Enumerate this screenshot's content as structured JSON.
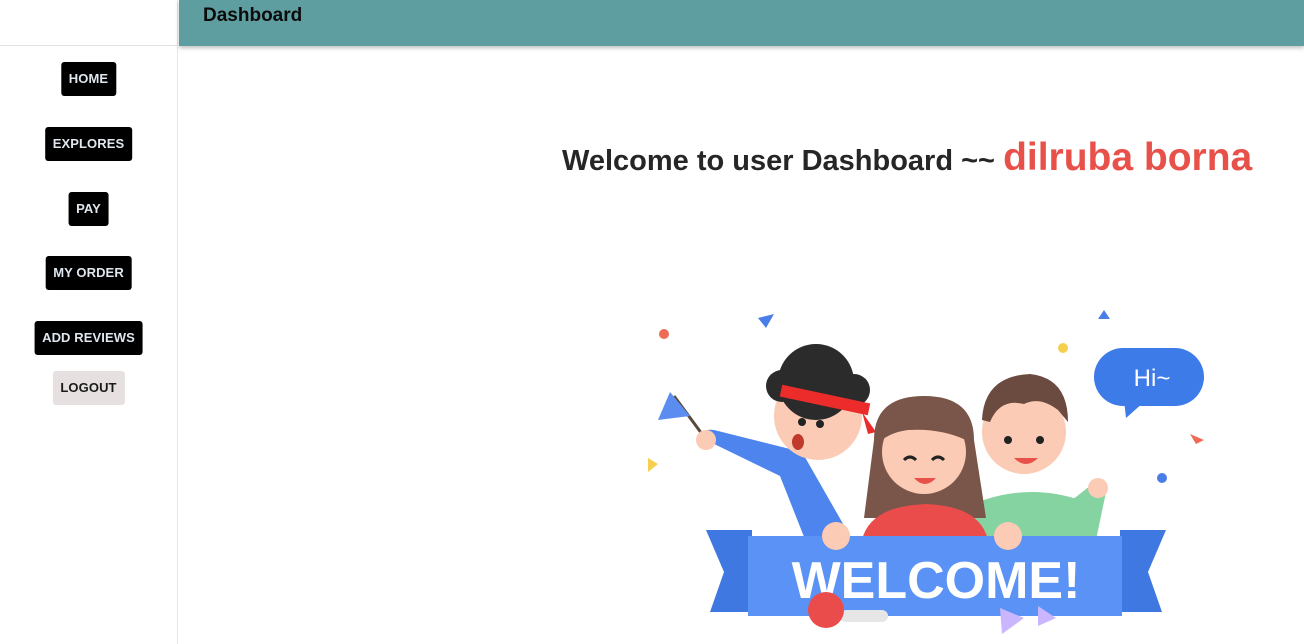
{
  "appbar": {
    "title": "Dashboard"
  },
  "sidebar": {
    "items": [
      {
        "label": "HOME"
      },
      {
        "label": "EXPLORES"
      },
      {
        "label": "PAY"
      },
      {
        "label": "MY ORDER"
      },
      {
        "label": "ADD REVIEWS"
      },
      {
        "label": "LOGOUT"
      }
    ]
  },
  "main": {
    "welcome_text": "Welcome to user Dashboard ~~",
    "user_name": "dilruba borna",
    "illustration": {
      "speech_bubble": "Hi~",
      "banner_text": "WELCOME!"
    }
  },
  "colors": {
    "appbar": "#5f9ea0",
    "user_name": "#e8514a",
    "nav_button": "#000000",
    "logout_button": "#e6e0e0"
  }
}
